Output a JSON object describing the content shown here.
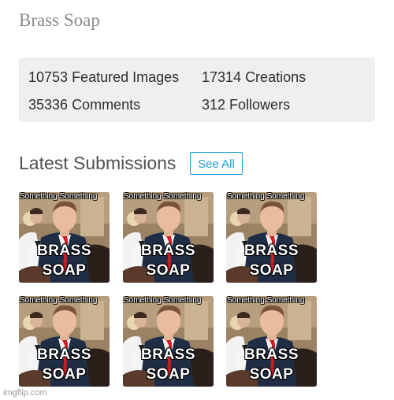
{
  "profile": {
    "title": "Brass Soap"
  },
  "stats": [
    {
      "value": "10753",
      "label": "Featured Images"
    },
    {
      "value": "17314",
      "label": "Creations"
    },
    {
      "value": "35336",
      "label": "Comments"
    },
    {
      "value": "312",
      "label": "Followers"
    }
  ],
  "submissions": {
    "heading": "Latest Submissions",
    "see_all_label": "See All",
    "items": [
      {
        "top_caption": "Something Something",
        "line1": "BRASS",
        "line2": "SOAP"
      },
      {
        "top_caption": "Something Something",
        "line1": "BRASS",
        "line2": "SOAP"
      },
      {
        "top_caption": "Something Something",
        "line1": "BRASS",
        "line2": "SOAP"
      },
      {
        "top_caption": "Something Something",
        "line1": "BRASS",
        "line2": "SOAP"
      },
      {
        "top_caption": "Something Something",
        "line1": "BRASS",
        "line2": "SOAP"
      },
      {
        "top_caption": "Something Something",
        "line1": "BRASS",
        "line2": "SOAP"
      }
    ]
  },
  "watermark": "imgflip.com",
  "colors": {
    "accent": "#1e9ad6",
    "stats_background": "#efefef",
    "title_text": "#8a8a8a"
  }
}
